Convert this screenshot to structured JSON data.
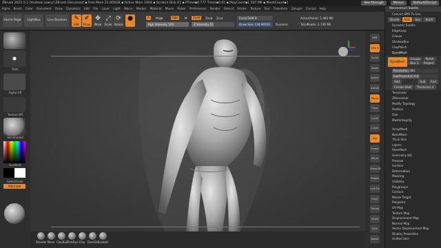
{
  "titlebar": {
    "text": "ZBrush 2021.5.1 [Andrew Lowry]   ZBrush Document   ▪ Free Mem 21.005GB ▪ Active Mem 1904 ▪ Scratch Disk 41 ▪ PTime▪0.777 Timer▪0.01 ▪ PolyCount▪1.507 MP ▪ MeshCount▪1",
    "see_through": "See-through",
    "menus_btn": "Menus",
    "script_btn": "DefaultZScript"
  },
  "menubar": [
    "Alpha",
    "Brush",
    "Color",
    "Document",
    "Draw",
    "Dynamics",
    "Edit",
    "File",
    "Layer",
    "Light",
    "Macro",
    "Marker",
    "Material",
    "Movie",
    "Picker",
    "Preferences",
    "Render",
    "Stencil",
    "Stroke",
    "Texture",
    "Tool",
    "Transform",
    "Zplugin",
    "Zscript",
    "Help"
  ],
  "toolbar": {
    "home_page": "Home Page",
    "lightbox": "LightBox",
    "live_boolean": "Live Boolean",
    "edit": "Edit",
    "draw": "Draw",
    "move": "Move",
    "scale": "Scale",
    "rotate": "Rotate",
    "a_tag": "A",
    "mrgb": "Mrgb",
    "rgb": "Rgb",
    "m": "M",
    "zadd": "Zadd",
    "zsub": "Zsub",
    "zcut": "Zcut",
    "rgb_intensity_label": "Rgb Intensity",
    "rgb_intensity": "100",
    "z_intensity_label": "Z Intensity",
    "z_intensity": "51",
    "focal_shift_label": "Focal Shift",
    "focal_shift": "0",
    "draw_size_label": "Draw Size",
    "draw_size": "118.96550",
    "dynamic": "Dynamic",
    "active_points": "ActivePoints: 1.482 Mil",
    "total_points": "TotalPoints: 1.740 Mil"
  },
  "left_tray": {
    "coords": "1.7,0.0 (1.00)",
    "dots_label": "Dots",
    "alpha_label": "Alpha Off",
    "texture_label": "Texture Off",
    "material_label": "SkinShade4",
    "gradient_label": "Gradient",
    "switch_color_label": "SwitchColor",
    "alternate_label": "Alternate"
  },
  "brushes": [
    "Standar",
    "Move",
    "ClayBuil",
    "TrimDyn",
    "Clay",
    "DamStd",
    "SnakeH"
  ],
  "right_tray": [
    "BPR",
    "SPix 3",
    "Scroll",
    "Zoom",
    "Actual",
    "AAHalf",
    "Persp",
    "Floor",
    "Local",
    "L.Sym",
    "Xyz",
    "Frame",
    "Move",
    "Zoom3D",
    "Rotate",
    "Line Fill",
    "PolyF",
    "Transp",
    "Ghost",
    "Solo",
    "Xpose"
  ],
  "panel": {
    "header": "Reconstruct Subdiv",
    "crease_line": "Convert BPR To Geo",
    "divide": "Divide",
    "smt": "Smt",
    "suv": "Suv",
    "rsmt": "ReUV",
    "items_top": [
      "Dynamic Subdiv",
      "EdgeLoop",
      "Crease",
      "ShadowBox",
      "ClayPolish"
    ],
    "dynamesh_header": "DynaMesh",
    "dynamesh_btn": "DynaMesh",
    "groups": "Groups",
    "polish": "Polish",
    "blur_label": "Blur 2",
    "project": "Project",
    "resolution_label": "Resolution",
    "resolution": "384",
    "subprojection_label": "SubProjection",
    "subprojection": "0.6",
    "add": "Add",
    "sub": "Sub",
    "and": "And",
    "create_shell": "Create Shell",
    "thickness_label": "Thickness",
    "thickness": "4",
    "items_mid": [
      "Tessimate",
      "ZRemesher",
      "Modify Topology",
      "Position",
      "Size",
      "MeshIntegrity"
    ],
    "items_bottom": [
      "ArrayMesh",
      "NanoMesh",
      "Thick Skin",
      "Layers",
      "FiberMesh",
      "Geometry HD",
      "Preview",
      "Surface",
      "Deformation",
      "Masking",
      "Visibility",
      "Polygroups",
      "Contact",
      "Morph Target",
      "Polypaint",
      "UV Map",
      "Texture Map",
      "Displacement Map",
      "Normal Map",
      "Vector Displacement Map",
      "Display Properties",
      "Unified Skin"
    ]
  },
  "colors": {
    "accent": "#e8862a",
    "panel_bg": "#2a2a2a",
    "viewport_bg": "#343434",
    "color_alternate": "#e8862a"
  },
  "intensities": {
    "rgb": 1.0,
    "z": 0.51
  }
}
